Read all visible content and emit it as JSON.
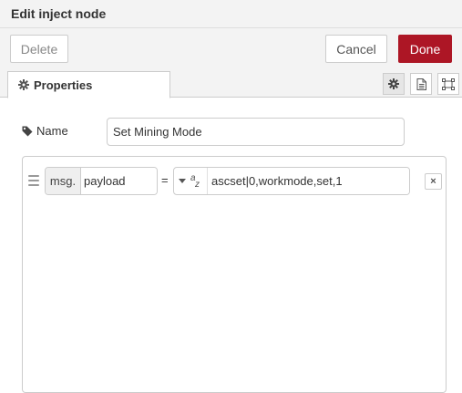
{
  "header": {
    "title": "Edit inject node"
  },
  "toolbar": {
    "delete_label": "Delete",
    "cancel_label": "Cancel",
    "done_label": "Done"
  },
  "tabs": [
    {
      "label": "Properties",
      "icon": "gear-icon",
      "active": true
    }
  ],
  "tab_buttons": [
    {
      "icon": "gear-icon",
      "active": true
    },
    {
      "icon": "description-icon",
      "active": false
    },
    {
      "icon": "appearance-icon",
      "active": false
    }
  ],
  "form": {
    "name_label": "Name",
    "name_value": "Set Mining Mode"
  },
  "properties": [
    {
      "prefix": "msg.",
      "property": "payload",
      "operator": "=",
      "value_type_icon": "string-type-icon",
      "value": "ascset|0,workmode,set,1",
      "remove_label": "×"
    }
  ],
  "colors": {
    "primary": "#ad1625",
    "border": "#cccccc",
    "toolbar_bg": "#f3f3f3"
  }
}
